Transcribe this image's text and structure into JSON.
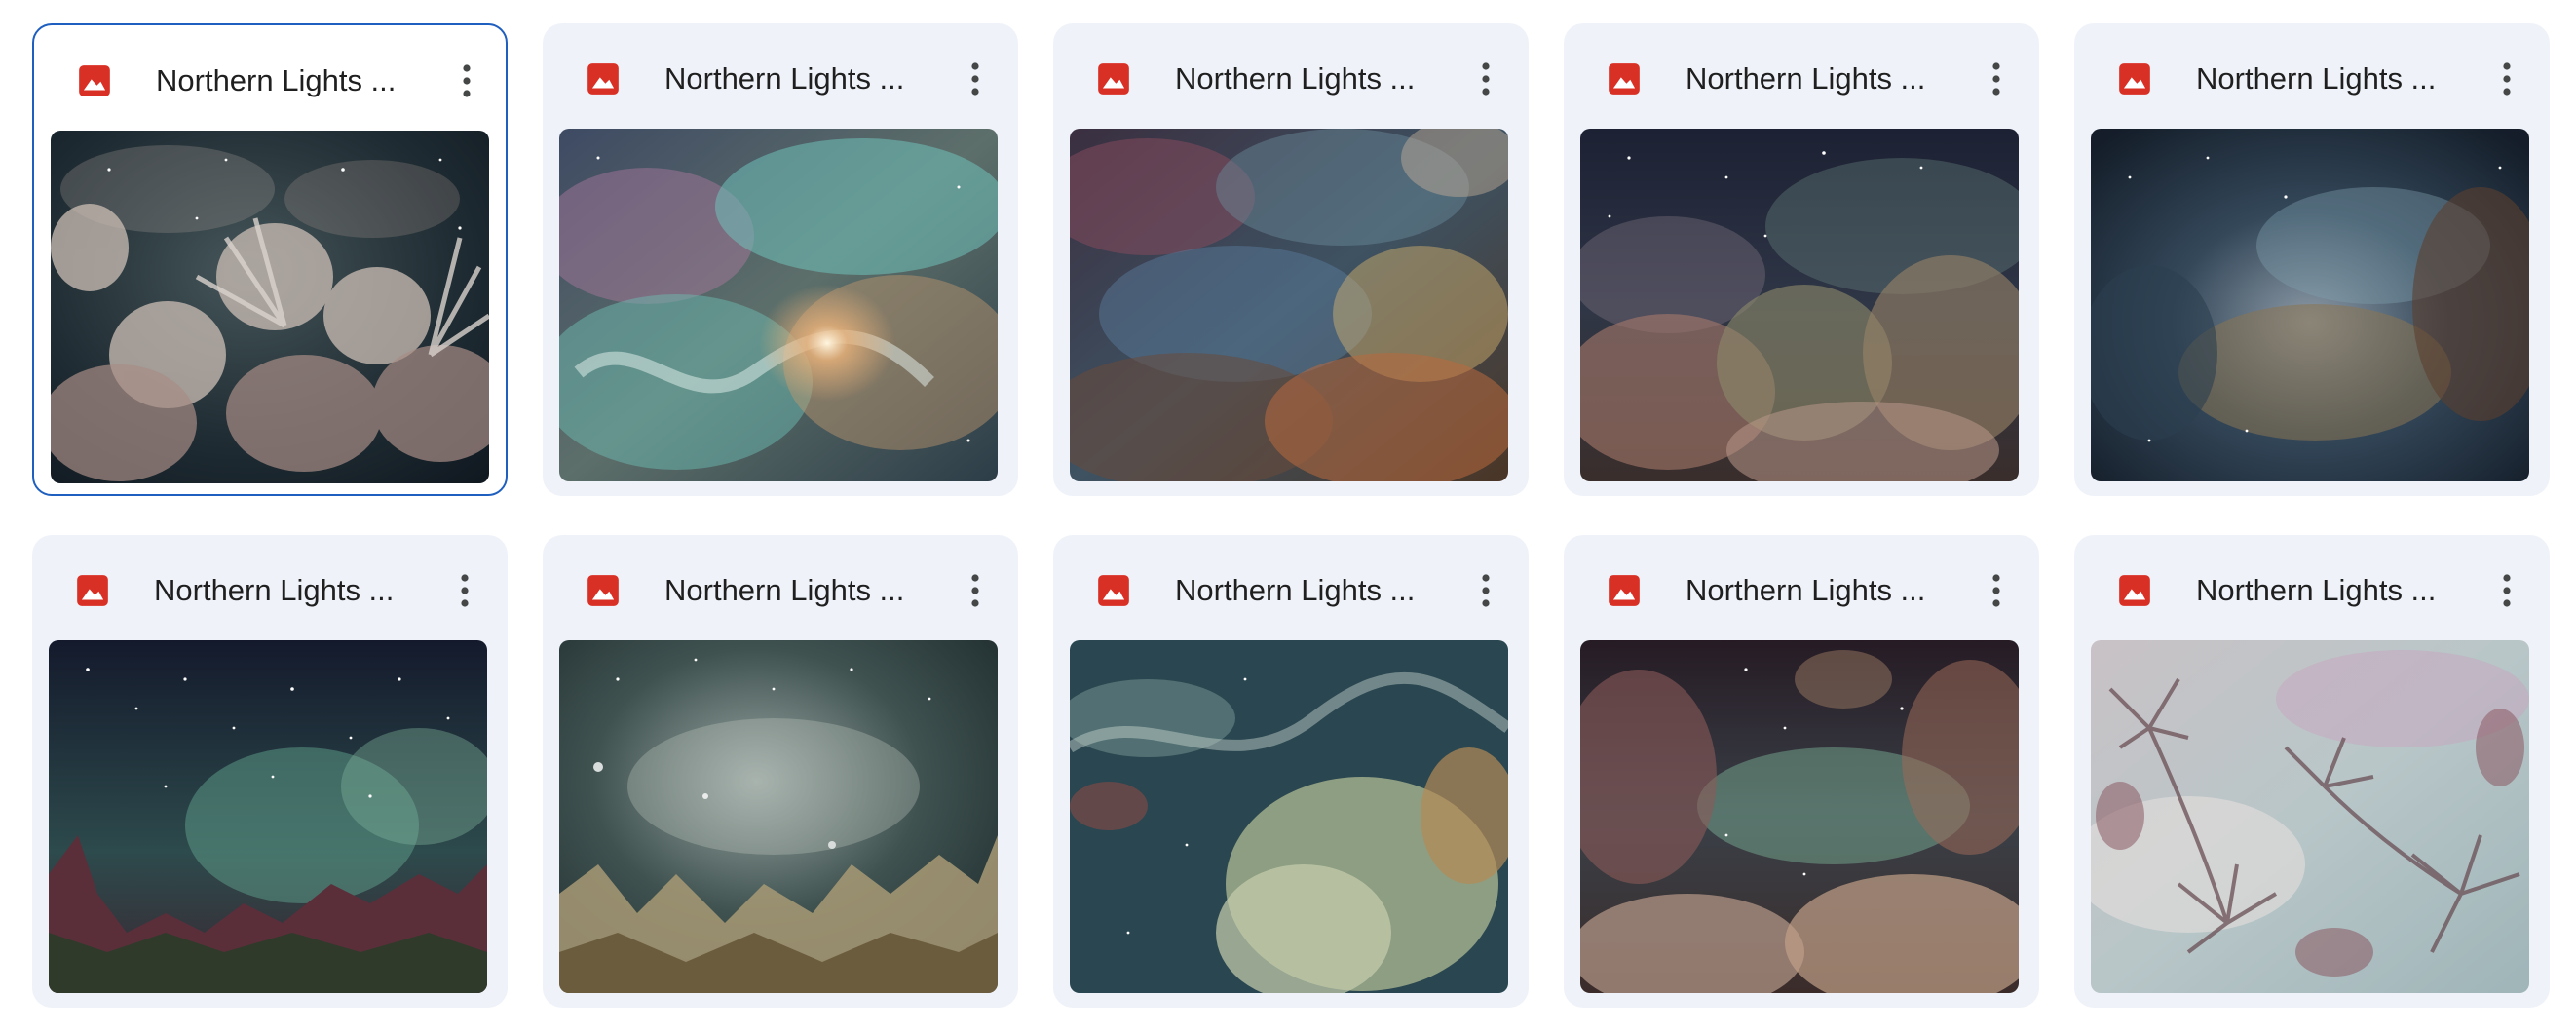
{
  "files": [
    {
      "name": "Northern Lights ...",
      "selected": true,
      "icon": "image-file-icon"
    },
    {
      "name": "Northern Lights ...",
      "selected": false,
      "icon": "image-file-icon"
    },
    {
      "name": "Northern Lights ...",
      "selected": false,
      "icon": "image-file-icon"
    },
    {
      "name": "Northern Lights ...",
      "selected": false,
      "icon": "image-file-icon"
    },
    {
      "name": "Northern Lights ...",
      "selected": false,
      "icon": "image-file-icon"
    },
    {
      "name": "Northern Lights ...",
      "selected": false,
      "icon": "image-file-icon"
    },
    {
      "name": "Northern Lights ...",
      "selected": false,
      "icon": "image-file-icon"
    },
    {
      "name": "Northern Lights ...",
      "selected": false,
      "icon": "image-file-icon"
    },
    {
      "name": "Northern Lights ...",
      "selected": false,
      "icon": "image-file-icon"
    },
    {
      "name": "Northern Lights ...",
      "selected": false,
      "icon": "image-file-icon"
    }
  ],
  "more_actions_icon": "more-vertical-icon",
  "colors": {
    "card_background": "#eff3f9",
    "selected_border": "#1f5fbf",
    "file_icon": "#d93025",
    "text": "#1f1f1f"
  }
}
